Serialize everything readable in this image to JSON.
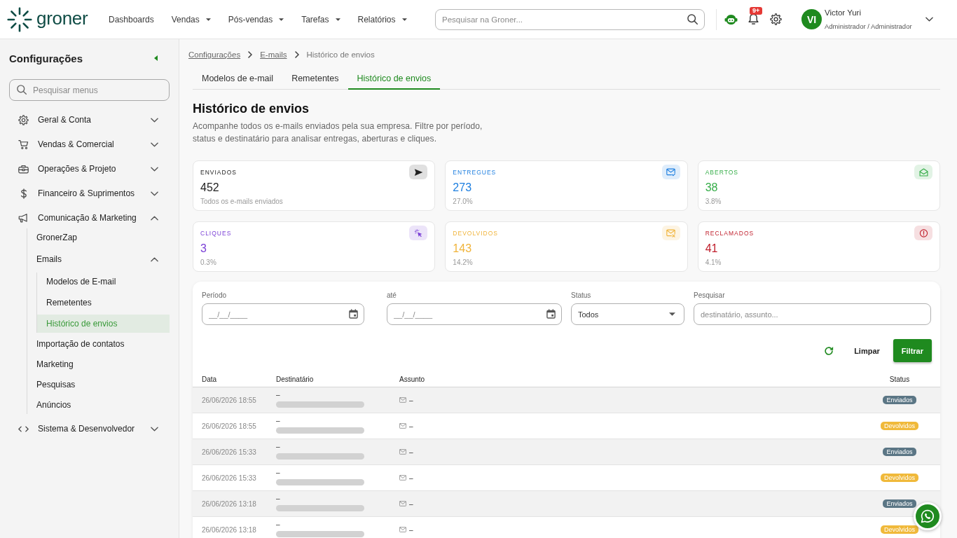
{
  "topbar": {
    "logo": "groner",
    "nav": [
      {
        "label": "Dashboards",
        "dropdown": false
      },
      {
        "label": "Vendas",
        "dropdown": true
      },
      {
        "label": "Pós-vendas",
        "dropdown": true
      },
      {
        "label": "Tarefas",
        "dropdown": true
      },
      {
        "label": "Relatórios",
        "dropdown": true
      }
    ],
    "search": {
      "placeholder": "Pesquisar na Groner..."
    },
    "notifications": {
      "badge": "9+"
    },
    "user": {
      "initials": "VI",
      "name": "Victor Yuri",
      "role": "Administrador / Administrador"
    }
  },
  "sidebar": {
    "title": "Configurações",
    "search": {
      "placeholder": "Pesquisar menus"
    },
    "items": [
      {
        "label": "Geral & Conta",
        "expanded": false,
        "selected": false
      },
      {
        "label": "Vendas & Comercial",
        "expanded": false,
        "selected": false
      },
      {
        "label": "Operações & Projeto",
        "expanded": false,
        "selected": false
      },
      {
        "label": "Financeiro & Suprimentos",
        "expanded": false,
        "selected": false
      },
      {
        "label": "Comunicação & Marketing",
        "expanded": true,
        "selected": false,
        "children": [
          {
            "label": "GronerZap",
            "selected": false
          },
          {
            "label": "Emails",
            "expanded": true,
            "selected": false,
            "children": [
              {
                "label": "Modelos de E-mail",
                "selected": false
              },
              {
                "label": "Remetentes",
                "selected": false
              },
              {
                "label": "Histórico de envios",
                "selected": true
              }
            ]
          },
          {
            "label": "Importação de contatos",
            "selected": false
          },
          {
            "label": "Marketing",
            "selected": false
          },
          {
            "label": "Pesquisas",
            "selected": false
          },
          {
            "label": "Anúncios",
            "selected": false
          }
        ]
      },
      {
        "label": "Sistema & Desenvolvedor",
        "expanded": false,
        "selected": false
      }
    ]
  },
  "breadcrumb": [
    {
      "label": "Configurações",
      "link": true
    },
    {
      "label": "E-mails",
      "link": true
    },
    {
      "label": "Histórico de envios",
      "link": false
    }
  ],
  "tabs": [
    {
      "label": "Modelos de e-mail",
      "selected": false
    },
    {
      "label": "Remetentes",
      "selected": false
    },
    {
      "label": "Histórico de envios",
      "selected": true
    }
  ],
  "page": {
    "title": "Histórico de envios",
    "description": "Acompanhe todos os e-mails enviados pela sua empresa. Filtre por período, status e destinatário para analisar entregas, aberturas e cliques."
  },
  "stats": [
    {
      "label": "ENVIADOS",
      "value": "452",
      "note": "Todos os e-mails enviados",
      "color": "#222222"
    },
    {
      "label": "ENTREGUES",
      "value": "273",
      "note": "27.0%",
      "color": "#1e7fe0"
    },
    {
      "label": "ABERTOS",
      "value": "38",
      "note": "3.8%",
      "color": "#35ad48"
    },
    {
      "label": "CLIQUES",
      "value": "3",
      "note": "0.3%",
      "color": "#7a3fd6"
    },
    {
      "label": "DEVOLVIDOS",
      "value": "143",
      "note": "14.2%",
      "color": "#f0b43c"
    },
    {
      "label": "RECLAMADOS",
      "value": "41",
      "note": "4.1%",
      "color": "#c01f2c"
    }
  ],
  "filters": {
    "fields": [
      {
        "kind": "date",
        "label": "Período",
        "placeholder": "__/__/____"
      },
      {
        "kind": "date",
        "label": "até",
        "placeholder": "__/__/____"
      },
      {
        "kind": "select",
        "label": "Status",
        "value": "Todos"
      },
      {
        "kind": "text",
        "label": "Pesquisar",
        "placeholder": "destinatário, assunto..."
      }
    ],
    "buttons": [
      {
        "kind": "secondary",
        "label": "Limpar"
      },
      {
        "kind": "primary",
        "label": "Filtrar"
      }
    ]
  },
  "table": {
    "columns": [
      "Data",
      "Destinatário",
      "Assunto",
      "Status"
    ],
    "rows": [
      {
        "date": "26/06/2026 18:55",
        "recipient": "–",
        "subject": "–",
        "status": "Enviados",
        "color": "#5b7685"
      },
      {
        "date": "26/06/2026 18:55",
        "recipient": "–",
        "subject": "–",
        "status": "Devolvidos",
        "color": "#f0b93a"
      },
      {
        "date": "26/06/2026 15:33",
        "recipient": "–",
        "subject": "–",
        "status": "Enviados",
        "color": "#5b7685"
      },
      {
        "date": "26/06/2026 15:33",
        "recipient": "–",
        "subject": "–",
        "status": "Devolvidos",
        "color": "#f0b93a"
      },
      {
        "date": "26/06/2026 13:18",
        "recipient": "–",
        "subject": "–",
        "status": "Enviados",
        "color": "#5b7685"
      },
      {
        "date": "26/06/2026 13:18",
        "recipient": "–",
        "subject": "–",
        "status": "Devolvidos",
        "color": "#f0b93a"
      }
    ]
  }
}
